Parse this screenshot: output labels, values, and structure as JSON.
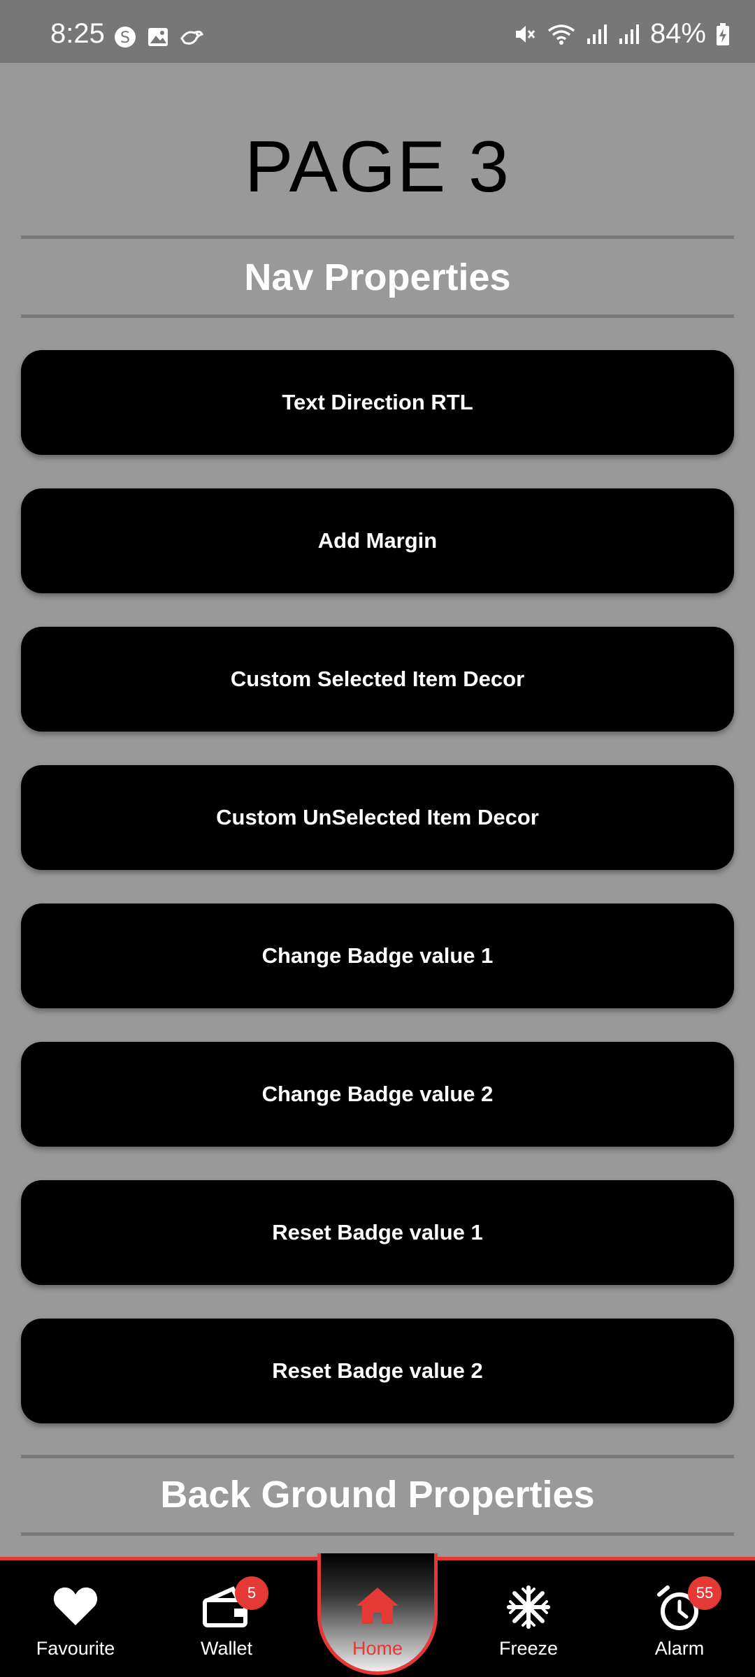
{
  "status_bar": {
    "time": "8:25",
    "battery": "84%",
    "left_icons": [
      "skype-icon",
      "image-icon",
      "bird-icon"
    ],
    "right_icons": [
      "mute-icon",
      "wifi-icon",
      "signal-icon",
      "signal-icon",
      "battery-charging-icon"
    ]
  },
  "page": {
    "title": "PAGE 3",
    "sections": [
      {
        "title": "Nav Properties"
      },
      {
        "title": "Back Ground Properties"
      }
    ]
  },
  "actions": [
    {
      "label": "Text Direction RTL"
    },
    {
      "label": "Add Margin"
    },
    {
      "label": "Custom Selected Item Decor"
    },
    {
      "label": "Custom UnSelected Item Decor"
    },
    {
      "label": "Change Badge value 1"
    },
    {
      "label": "Change Badge value 2"
    },
    {
      "label": "Reset Badge value 1"
    },
    {
      "label": "Reset Badge value 2"
    }
  ],
  "bottom_nav": {
    "accent_color": "#e53935",
    "items": [
      {
        "label": "Favourite",
        "icon": "heart-icon",
        "badge": null,
        "selected": false
      },
      {
        "label": "Wallet",
        "icon": "wallet-icon",
        "badge": "5",
        "selected": false
      },
      {
        "label": "Home",
        "icon": "home-icon",
        "badge": null,
        "selected": true
      },
      {
        "label": "Freeze",
        "icon": "snowflake-icon",
        "badge": null,
        "selected": false
      },
      {
        "label": "Alarm",
        "icon": "alarm-icon",
        "badge": "55",
        "selected": false
      }
    ]
  }
}
